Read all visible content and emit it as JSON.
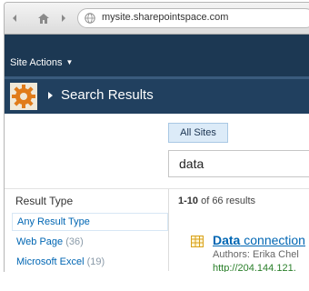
{
  "browser": {
    "url": "mysite.sharepointspace.com",
    "back_icon": "back-arrow-icon",
    "forward_icon": "forward-arrow-icon",
    "home_icon": "home-icon",
    "globe_icon": "globe-icon"
  },
  "ribbon": {
    "site_actions_label": "Site Actions"
  },
  "title_bar": {
    "page_title": "Search Results",
    "logo_icon": "gear-logo-icon"
  },
  "search": {
    "scope_tab": "All Sites",
    "query": "data"
  },
  "refinement": {
    "title": "Result Type",
    "items": [
      {
        "label": "Any Result Type",
        "count": ""
      },
      {
        "label": "Web Page",
        "count": "(36)"
      },
      {
        "label": "Microsoft Excel",
        "count": "(19)"
      }
    ]
  },
  "results": {
    "range": "1-10",
    "summary_rest": " of 66 results",
    "first": {
      "title_highlight": "Data",
      "title_rest": " connection",
      "authors": "Authors: Erika Chel",
      "url": "http://204.144.121."
    }
  },
  "colors": {
    "ribbon": "#1c3853",
    "title_bar": "#21405f",
    "link": "#0066b3",
    "url_green": "#2a7f2a"
  }
}
